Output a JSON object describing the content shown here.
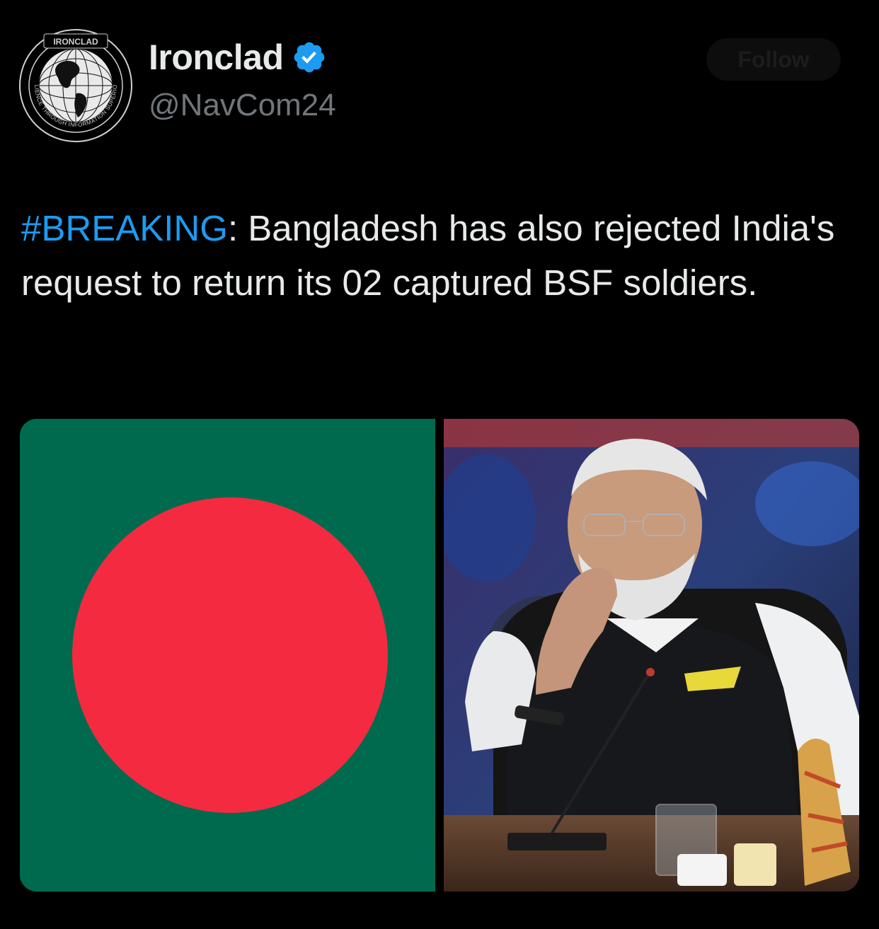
{
  "author": {
    "display_name": "Ironclad",
    "handle": "@NavCom24",
    "verified_icon": "verified-badge-icon",
    "avatar": {
      "top_text": "IRONCLAD",
      "ring_text": "RESILIENCE THROUGH INFORMATION SUPERIORITY"
    }
  },
  "follow_label": "Follow",
  "tweet": {
    "hashtag": "#BREAKING",
    "body": ": Bangladesh has also rejected India's request to return its 02 captured BSF soldiers."
  },
  "media": {
    "left_image": "bangladesh-flag",
    "right_image": "man-seated-at-conference-table",
    "colors": {
      "flag_green": "#006a4e",
      "flag_red": "#f42a41"
    }
  },
  "colors": {
    "accent": "#1d9bf0",
    "background": "#000000",
    "secondary_text": "#71767b"
  }
}
